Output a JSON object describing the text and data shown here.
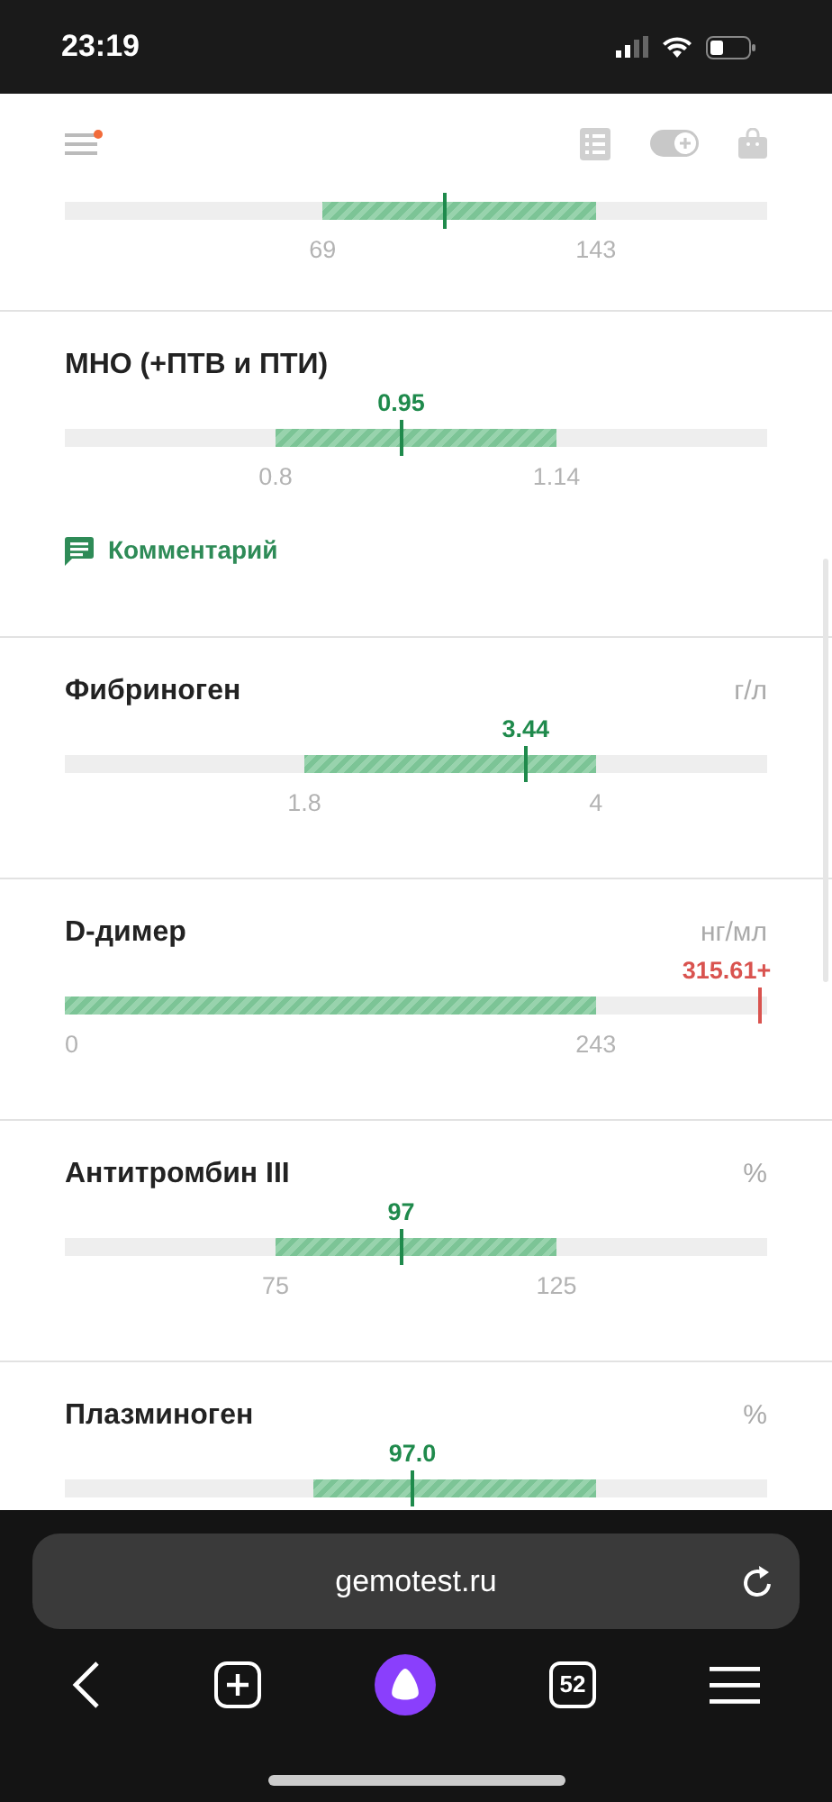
{
  "status_bar": {
    "time": "23:19"
  },
  "header": {
    "menu_notification": true
  },
  "indicators": [
    {
      "out_of_range": false,
      "marker": {
        "level": 0.541
      },
      "low_label": "69",
      "high_label": "143"
    },
    {
      "title": "МНО (+ПТВ и ПТИ)",
      "value": "0.95",
      "out_of_range": false,
      "marker": {
        "level": 0.479
      },
      "low_label": "0.8",
      "high_label": "1.14",
      "comment": "Комментарий"
    },
    {
      "title": "Фибриноген",
      "unit": "г/л",
      "value": "3.44",
      "out_of_range": false,
      "marker": {
        "level": 0.656
      },
      "low_label": "1.8",
      "high_label": "4"
    },
    {
      "title": "D-димер",
      "unit": "нг/мл",
      "value": "315.61+",
      "out_of_range": true,
      "marker": {
        "level": 0.99
      },
      "low_label": "0",
      "high_label": "243"
    },
    {
      "title": "Антитромбин III",
      "unit": "%",
      "value": "97",
      "out_of_range": false,
      "marker": {
        "level": 0.479
      },
      "low_label": "75",
      "high_label": "125"
    },
    {
      "title": "Плазминоген",
      "unit": "%",
      "value": "97.0",
      "out_of_range": false,
      "marker": {
        "level": 0.495
      }
    }
  ],
  "browser": {
    "url": "gemotest.ru",
    "tab_count": "52"
  }
}
